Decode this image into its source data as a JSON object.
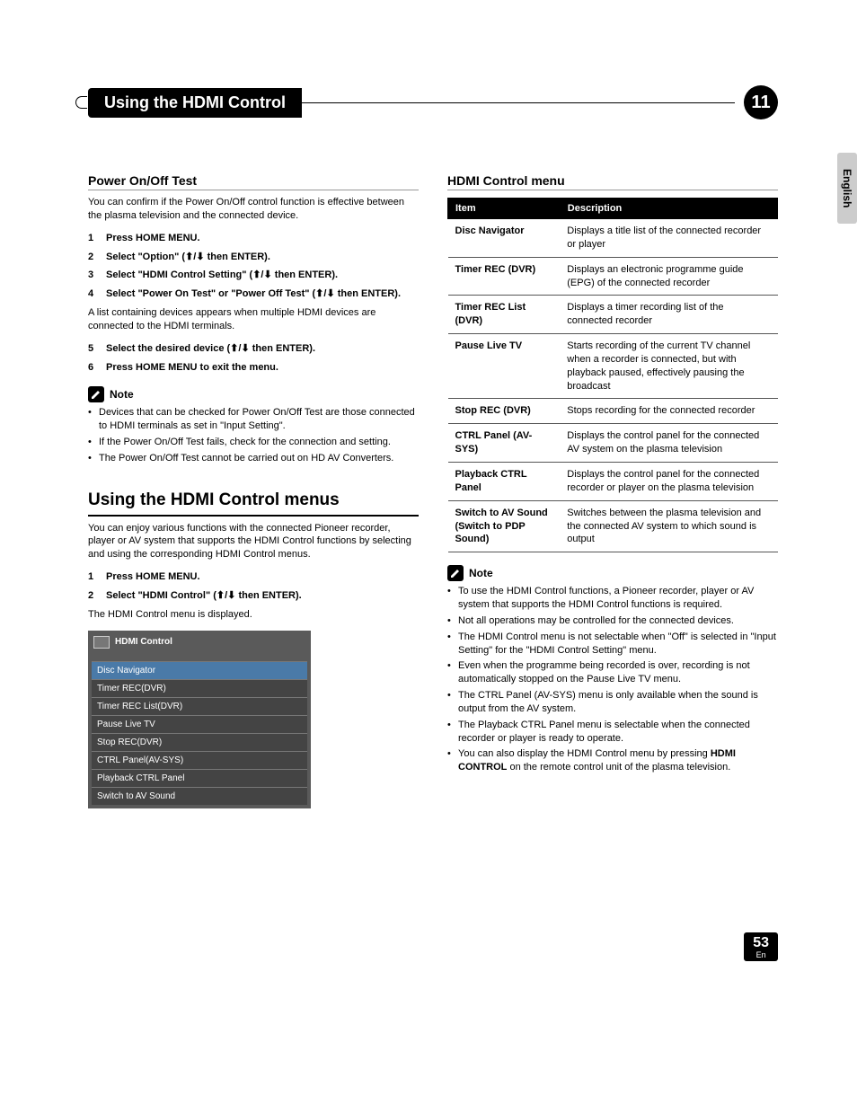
{
  "header": {
    "title": "Using the HDMI Control",
    "chapter": "11"
  },
  "language_tab": "English",
  "leftCol": {
    "section1_title": "Power On/Off Test",
    "section1_intro": "You can confirm if the Power On/Off control function is effective between the plasma television and the connected device.",
    "steps_a": [
      {
        "n": "1",
        "bold": "Press HOME MENU."
      },
      {
        "n": "2",
        "bold": "Select \"Option\" (",
        "arrows": "⬆/⬇",
        "after": " then ENTER)."
      },
      {
        "n": "3",
        "bold": "Select \"HDMI Control Setting\" (",
        "arrows": "⬆/⬇",
        "after": " then ENTER)."
      },
      {
        "n": "4",
        "bold": "Select \"Power On Test\" or \"Power Off Test\" (",
        "arrows": "⬆/⬇",
        "after": " then ENTER)."
      }
    ],
    "after_step4": "A list containing devices appears when multiple HDMI devices are connected to the HDMI terminals.",
    "steps_b": [
      {
        "n": "5",
        "bold": "Select the desired device (",
        "arrows": "⬆/⬇",
        "after": " then ENTER)."
      },
      {
        "n": "6",
        "bold": "Press HOME MENU to exit the menu."
      }
    ],
    "note_label": "Note",
    "notes1": [
      "Devices that can be checked for Power On/Off Test are those connected to HDMI terminals as set in \"Input Setting\".",
      "If the Power On/Off Test fails, check for the connection and setting.",
      "The Power On/Off Test cannot be carried out on HD AV Converters."
    ],
    "big_section_title": "Using the HDMI Control menus",
    "big_section_intro": "You can enjoy various functions with the connected Pioneer recorder, player or AV system that supports the HDMI Control functions by selecting and using the corresponding HDMI Control menus.",
    "steps_c": [
      {
        "n": "1",
        "bold": "Press HOME MENU."
      },
      {
        "n": "2",
        "bold": "Select \"HDMI Control\" (",
        "arrows": "⬆/⬇",
        "after": " then ENTER)."
      }
    ],
    "after_steps_c": "The HDMI Control menu is displayed.",
    "menu_title": "HDMI Control",
    "menu_items": [
      "Disc Navigator",
      "Timer REC(DVR)",
      "Timer REC List(DVR)",
      "Pause Live TV",
      "Stop REC(DVR)",
      "CTRL Panel(AV-SYS)",
      "Playback CTRL Panel",
      "Switch to AV Sound"
    ]
  },
  "rightCol": {
    "section_title": "HDMI Control menu",
    "table_header_item": "Item",
    "table_header_desc": "Description",
    "table_rows": [
      {
        "item": "Disc Navigator",
        "desc": "Displays a title list of the connected recorder or player"
      },
      {
        "item": "Timer REC (DVR)",
        "desc": "Displays an electronic programme guide (EPG) of the connected recorder"
      },
      {
        "item": "Timer REC List (DVR)",
        "desc": "Displays a timer recording list of the connected recorder"
      },
      {
        "item": "Pause Live TV",
        "desc": "Starts recording of the current TV channel when a recorder is connected, but with playback paused, effectively pausing the broadcast"
      },
      {
        "item": "Stop REC (DVR)",
        "desc": "Stops recording for the connected recorder"
      },
      {
        "item": "CTRL Panel (AV-SYS)",
        "desc": "Displays the control panel for the connected AV system on the plasma television"
      },
      {
        "item": "Playback CTRL Panel",
        "desc": "Displays the control panel for the connected recorder or player on the plasma television"
      },
      {
        "item": "Switch to AV Sound (Switch to PDP Sound)",
        "desc": "Switches between the plasma television and the connected AV system to which sound is output"
      }
    ],
    "note_label": "Note",
    "notes2": [
      "To use the HDMI Control functions, a Pioneer recorder, player or AV system that supports the HDMI Control functions is required.",
      "Not all operations may be controlled for the connected devices.",
      "The HDMI Control menu is not selectable when \"Off\" is selected in \"Input Setting\" for the \"HDMI Control Setting\" menu.",
      "Even when the programme being recorded is over, recording is not automatically stopped on the Pause Live TV menu.",
      "The CTRL Panel (AV-SYS) menu is only available when the sound is output from the AV system.",
      "The Playback CTRL Panel menu is selectable when the connected recorder or player is ready to operate."
    ],
    "note_last_pre": "You can also display the HDMI Control menu by pressing ",
    "note_last_bold": "HDMI CONTROL",
    "note_last_post": " on the remote control unit of the plasma television."
  },
  "footer": {
    "page": "53",
    "lang": "En"
  }
}
